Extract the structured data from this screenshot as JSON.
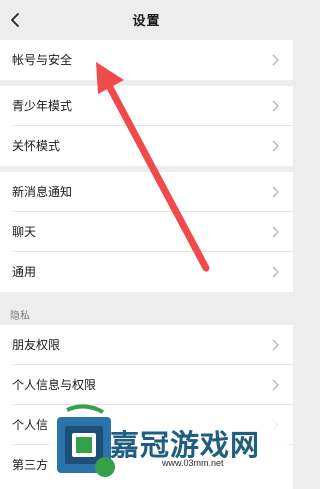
{
  "header": {
    "title": "设置"
  },
  "rows": [
    {
      "label": "帐号与安全"
    },
    {
      "label": "青少年模式"
    },
    {
      "label": "关怀模式"
    },
    {
      "label": "新消息通知"
    },
    {
      "label": "聊天"
    },
    {
      "label": "通用"
    },
    {
      "label": "朋友权限"
    },
    {
      "label": "个人信息与权限"
    },
    {
      "label": "个人信"
    },
    {
      "label": "第三方"
    }
  ],
  "sections": {
    "privacy": "隐私"
  },
  "watermark": {
    "brand": "嘉冠游戏网",
    "url": "www.03mm.net"
  },
  "colors": {
    "background": "#ededed",
    "row": "#ffffff",
    "arrow": "#f04a4a",
    "brand": "#1f5e80"
  }
}
